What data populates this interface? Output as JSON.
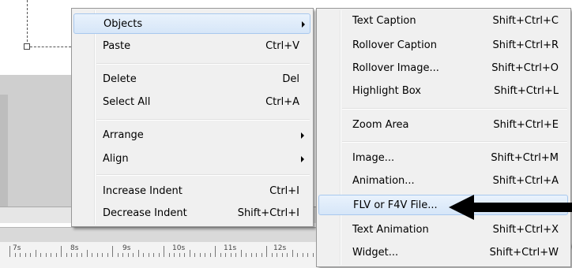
{
  "main_menu": {
    "items": [
      {
        "label": "Objects",
        "shortcut": "",
        "submenu": true,
        "highlighted": true
      },
      {
        "label": "Paste",
        "shortcut": "Ctrl+V",
        "submenu": false
      },
      {
        "label": "Delete",
        "shortcut": "Del",
        "submenu": false
      },
      {
        "label": "Select All",
        "shortcut": "Ctrl+A",
        "submenu": false
      },
      {
        "label": "Arrange",
        "shortcut": "",
        "submenu": true
      },
      {
        "label": "Align",
        "shortcut": "",
        "submenu": true
      },
      {
        "label": "Increase Indent",
        "shortcut": "Ctrl+I",
        "submenu": false
      },
      {
        "label": "Decrease Indent",
        "shortcut": "Shift+Ctrl+I",
        "submenu": false
      }
    ]
  },
  "objects_submenu": {
    "items": [
      {
        "label": "Text Caption",
        "shortcut": "Shift+Ctrl+C"
      },
      {
        "label": "Rollover Caption",
        "shortcut": "Shift+Ctrl+R"
      },
      {
        "label": "Rollover Image...",
        "shortcut": "Shift+Ctrl+O"
      },
      {
        "label": "Highlight Box",
        "shortcut": "Shift+Ctrl+L"
      },
      {
        "label": "Zoom Area",
        "shortcut": "Shift+Ctrl+E"
      },
      {
        "label": "Image...",
        "shortcut": "Shift+Ctrl+M"
      },
      {
        "label": "Animation...",
        "shortcut": "Shift+Ctrl+A"
      },
      {
        "label": "FLV or F4V File...",
        "shortcut": "",
        "highlighted": true
      },
      {
        "label": "Text Animation",
        "shortcut": "Shift+Ctrl+X"
      },
      {
        "label": "Widget...",
        "shortcut": "Shift+Ctrl+W"
      }
    ]
  },
  "timeline_ruler": {
    "labels": [
      "7s",
      "8s",
      "9s",
      "10s",
      "11s",
      "12s"
    ]
  },
  "colors": {
    "menu_bg": "#f0f0f0",
    "highlight": "#d6e6f8",
    "pointer_arrow": "#000000"
  },
  "icons": {
    "submenu_arrow": "triangle-right",
    "annotation_pointer": "left-arrow"
  }
}
